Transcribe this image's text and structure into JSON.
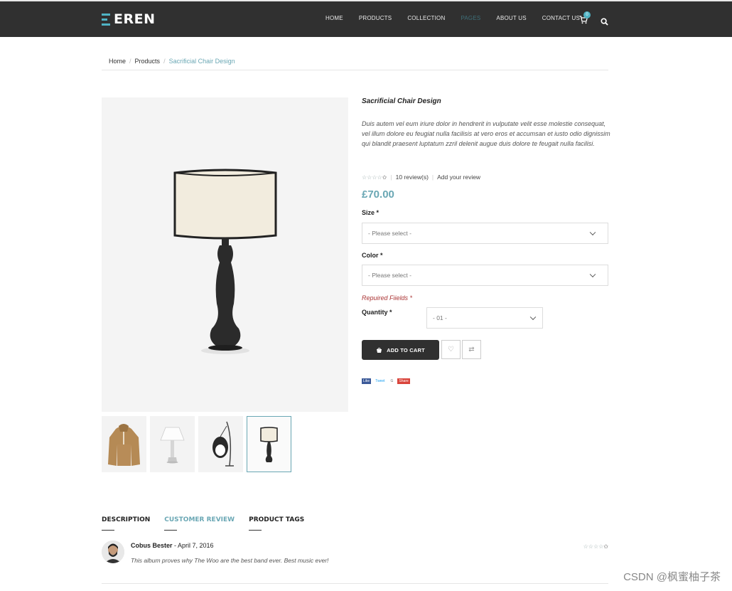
{
  "header": {
    "logo_text": "EREN",
    "nav": [
      "HOME",
      "PRODUCTS",
      "COLLECTION",
      "PAGES",
      "ABOUT US",
      "CONTACT US"
    ],
    "active_nav": "PAGES",
    "cart_count": "0",
    "accent_color": "#4fb3c4",
    "bar_color": "#303030"
  },
  "breadcrumb": {
    "home": "Home",
    "products": "Products",
    "current": "Sacrificial Chair Design"
  },
  "product": {
    "title": "Sacrificial Chair Design",
    "description": "Duis autem vel eum iriure dolor in hendrerit in vulputate velit esse molestie consequat, vel illum dolore eu feugiat nulla facilisis at vero eros et accumsan et iusto odio dignissim qui blandit praesent luptatum zzril delenit augue duis dolore te feugait nulla facilisi.",
    "rating": 0.2,
    "reviews_link": "10 review(s)",
    "add_review_link": "Add your review",
    "price": "£70.00",
    "size_label": "Size *",
    "size_placeholder": "- Please select -",
    "color_label": "Color *",
    "color_placeholder": "- Please select -",
    "required_note": "Repuired Fiields *",
    "quantity_label": "Quantity *",
    "quantity_value": "- 01 -",
    "add_to_cart": "ADD TO CART",
    "price_color": "#6aa7b4",
    "images": [
      "jacket",
      "white lamp",
      "hanging chair",
      "black lamp"
    ],
    "selected_thumb": 4
  },
  "social": {
    "like": "Like",
    "tweet": "Tweet",
    "google": "G",
    "share": "Share"
  },
  "tabs": {
    "items": [
      "DESCRIPTION",
      "CUSTOMER REVIEW",
      "PRODUCT TAGS"
    ],
    "active": "CUSTOMER REVIEW"
  },
  "review": {
    "author": "Cobus Bester",
    "date": " - April 7, 2016",
    "text": "This album proves why The Woo are the best band ever. Best music ever!",
    "rating": 0.2
  },
  "watermark": "CSDN @枫蜜柚子茶"
}
